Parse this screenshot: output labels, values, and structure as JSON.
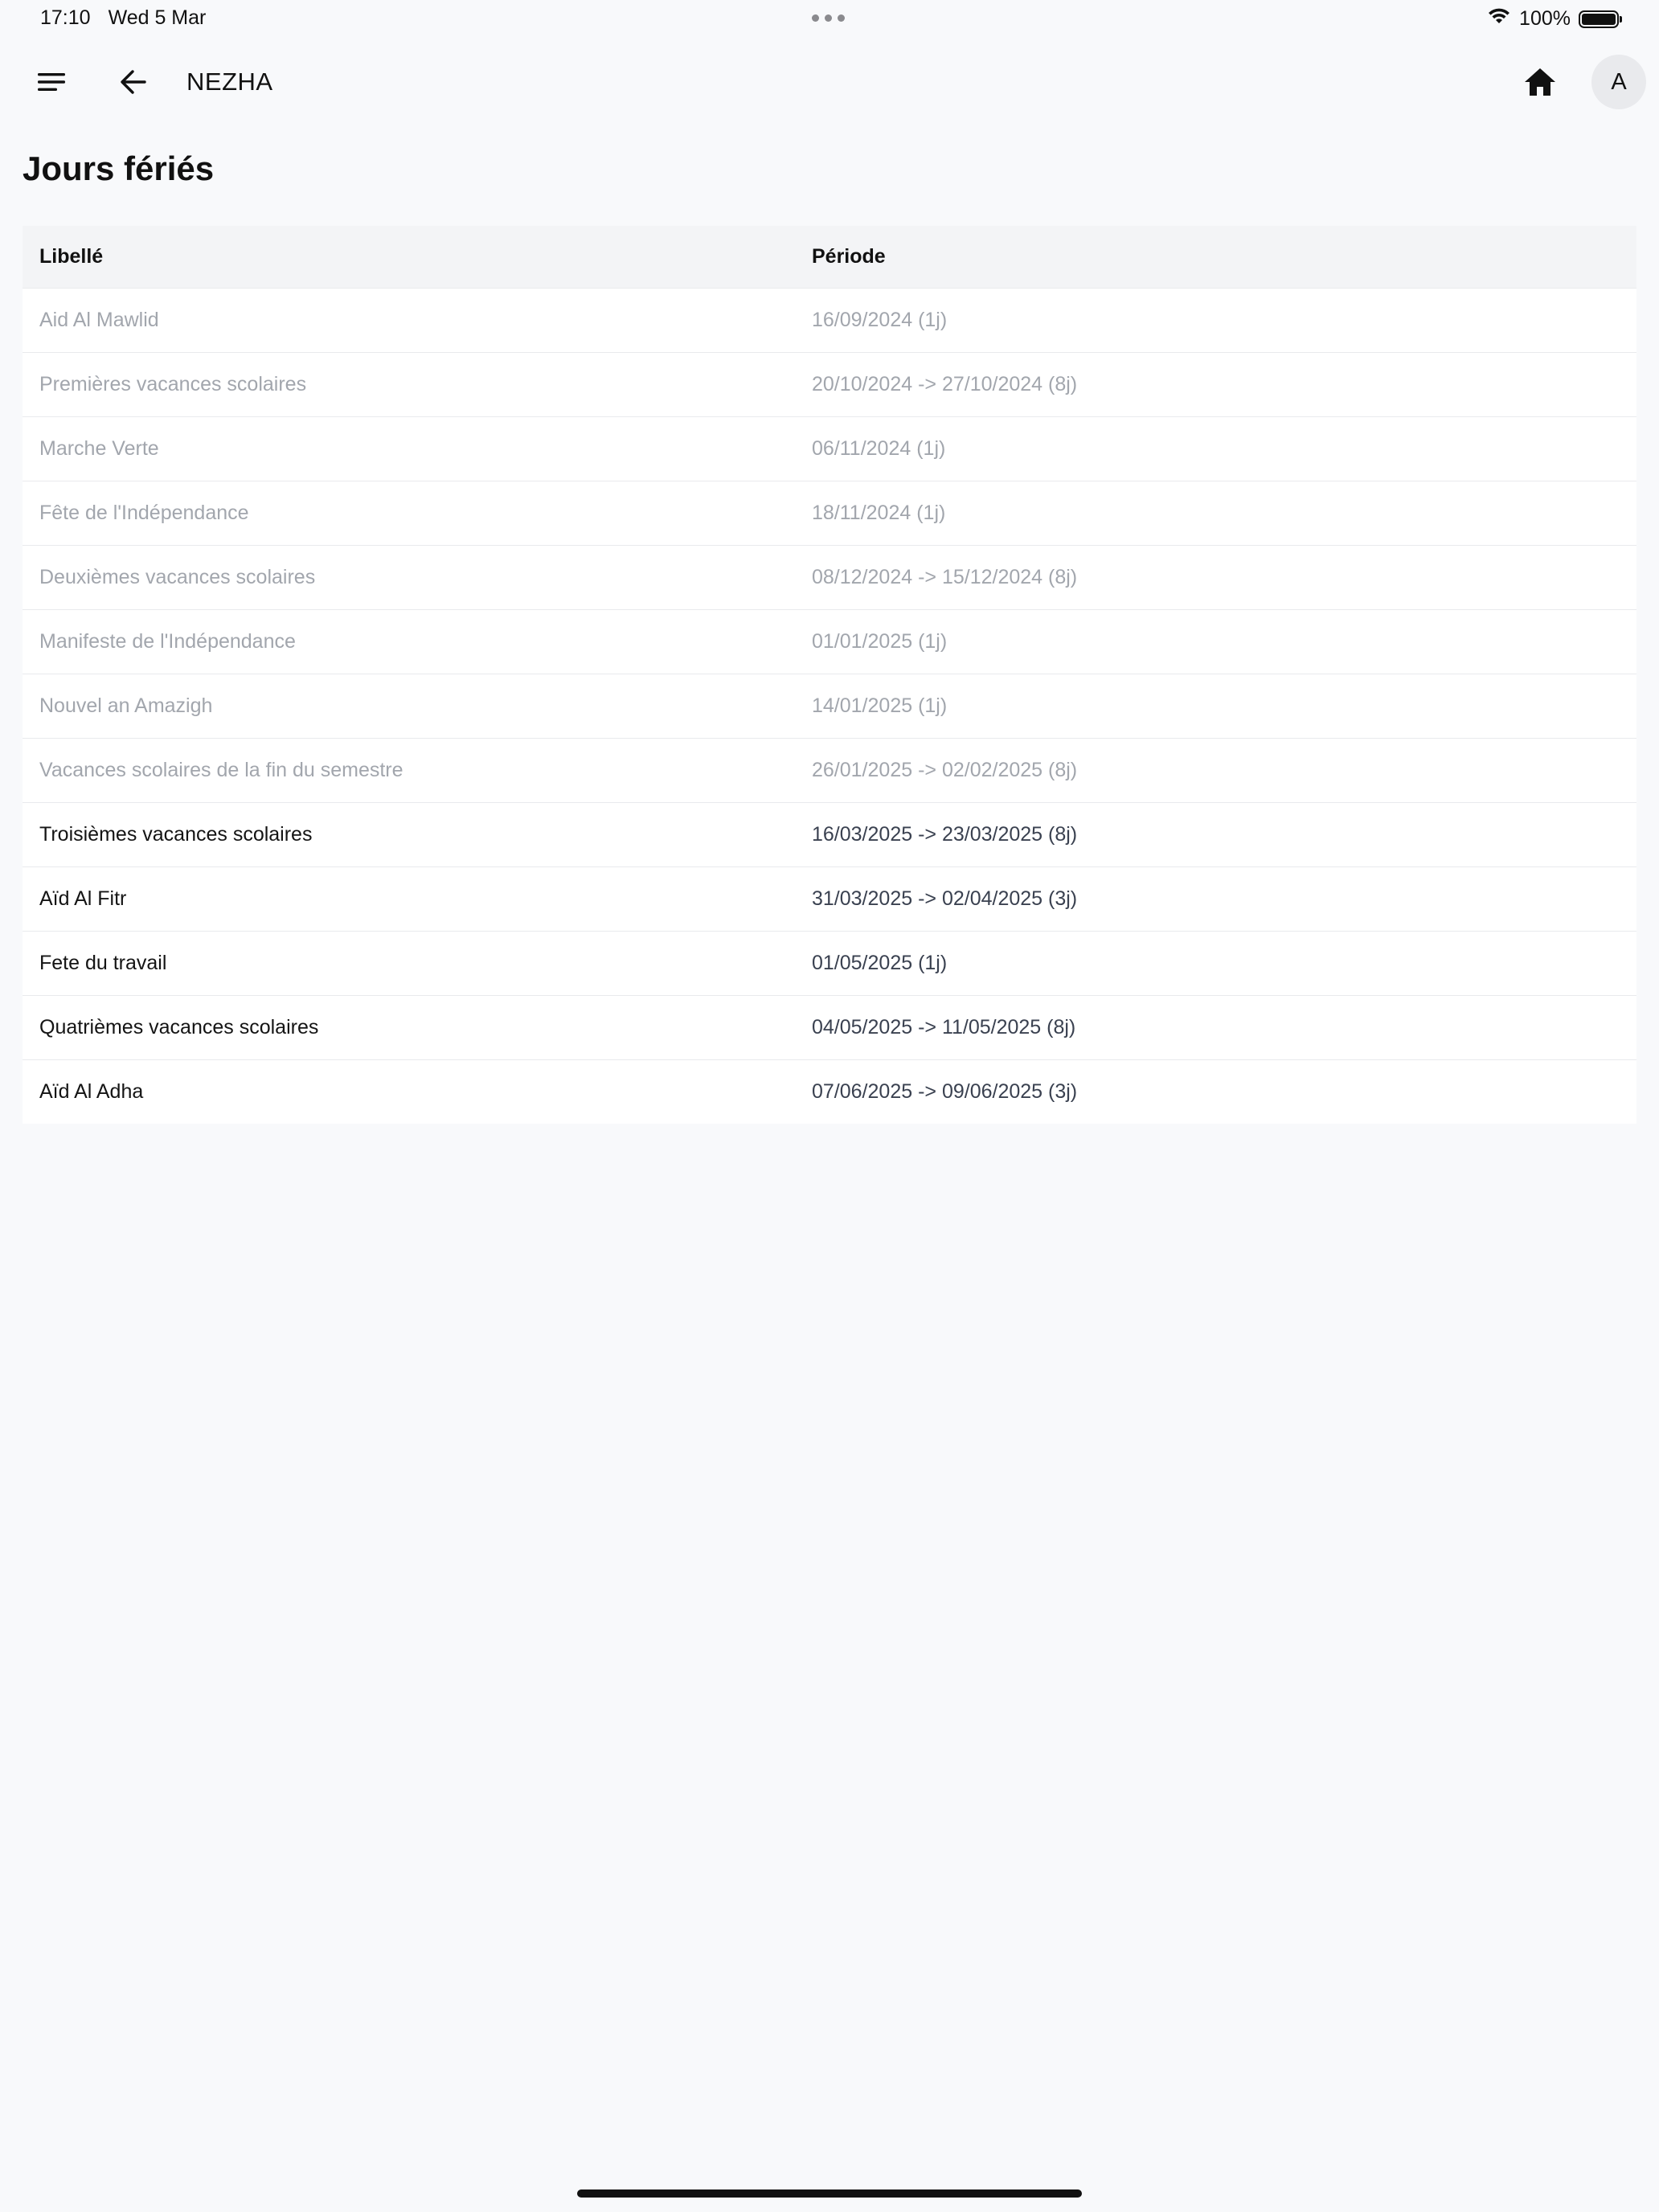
{
  "status_bar": {
    "time": "17:10",
    "date": "Wed 5 Mar",
    "battery": "100%",
    "battery_level": 1.0
  },
  "app_bar": {
    "title": "NEZHA",
    "menu_icon": "menu-icon",
    "back_icon": "arrow-left-icon",
    "home_icon": "home-icon",
    "avatar_initial": "A"
  },
  "page": {
    "title": "Jours fériés"
  },
  "table": {
    "columns": [
      "Libellé",
      "Période"
    ],
    "rows": [
      {
        "label": "Aid Al Mawlid",
        "period": "16/09/2024 (1j)",
        "status": "past"
      },
      {
        "label": "Premières vacances scolaires",
        "period": "20/10/2024 -> 27/10/2024 (8j)",
        "status": "past"
      },
      {
        "label": "Marche Verte",
        "period": "06/11/2024 (1j)",
        "status": "past"
      },
      {
        "label": "Fête de l'Indépendance",
        "period": "18/11/2024 (1j)",
        "status": "past"
      },
      {
        "label": "Deuxièmes vacances scolaires",
        "period": "08/12/2024 -> 15/12/2024 (8j)",
        "status": "past"
      },
      {
        "label": "Manifeste de l'Indépendance",
        "period": "01/01/2025 (1j)",
        "status": "past"
      },
      {
        "label": "Nouvel an Amazigh",
        "period": "14/01/2025 (1j)",
        "status": "past"
      },
      {
        "label": "Vacances scolaires de la fin du semestre",
        "period": "26/01/2025 -> 02/02/2025 (8j)",
        "status": "past"
      },
      {
        "label": "Troisièmes vacances scolaires",
        "period": "16/03/2025 -> 23/03/2025 (8j)",
        "status": "current"
      },
      {
        "label": "Aïd Al Fitr",
        "period": "31/03/2025 -> 02/04/2025 (3j)",
        "status": "current"
      },
      {
        "label": "Fete du travail",
        "period": "01/05/2025 (1j)",
        "status": "current"
      },
      {
        "label": "Quatrièmes vacances scolaires",
        "period": "04/05/2025 -> 11/05/2025 (8j)",
        "status": "current"
      },
      {
        "label": "Aïd Al Adha",
        "period": "07/06/2025 -> 09/06/2025 (3j)",
        "status": "current"
      }
    ]
  },
  "colors": {
    "background": "#f8f9fb",
    "header_row": "#f3f4f6",
    "past_text": "#a2a6ad",
    "current_text": "#141414"
  }
}
